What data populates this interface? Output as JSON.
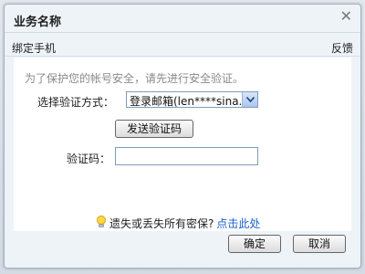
{
  "dialog": {
    "title": "业务名称",
    "subtitle": "绑定手机",
    "feedback": "反馈",
    "notice": "为了保护您的帐号安全，请先进行安全验证。",
    "method_label": "选择验证方式：",
    "method_value": "登录邮箱(len****sina.com)",
    "send_button": "发送验证码",
    "code_label": "验证码：",
    "code_value": "",
    "help_text": "遗失或丢失所有密保?",
    "help_link": "点击此处",
    "ok_button": "确定",
    "cancel_button": "取消"
  },
  "icons": [
    "close-icon",
    "chevron-down-icon",
    "lightbulb-icon"
  ],
  "colors": {
    "dialog_bg": "#eef3f8",
    "content_bg": "#ffffff",
    "link": "#1b5ec9",
    "notice_text": "#8a8a8a"
  }
}
